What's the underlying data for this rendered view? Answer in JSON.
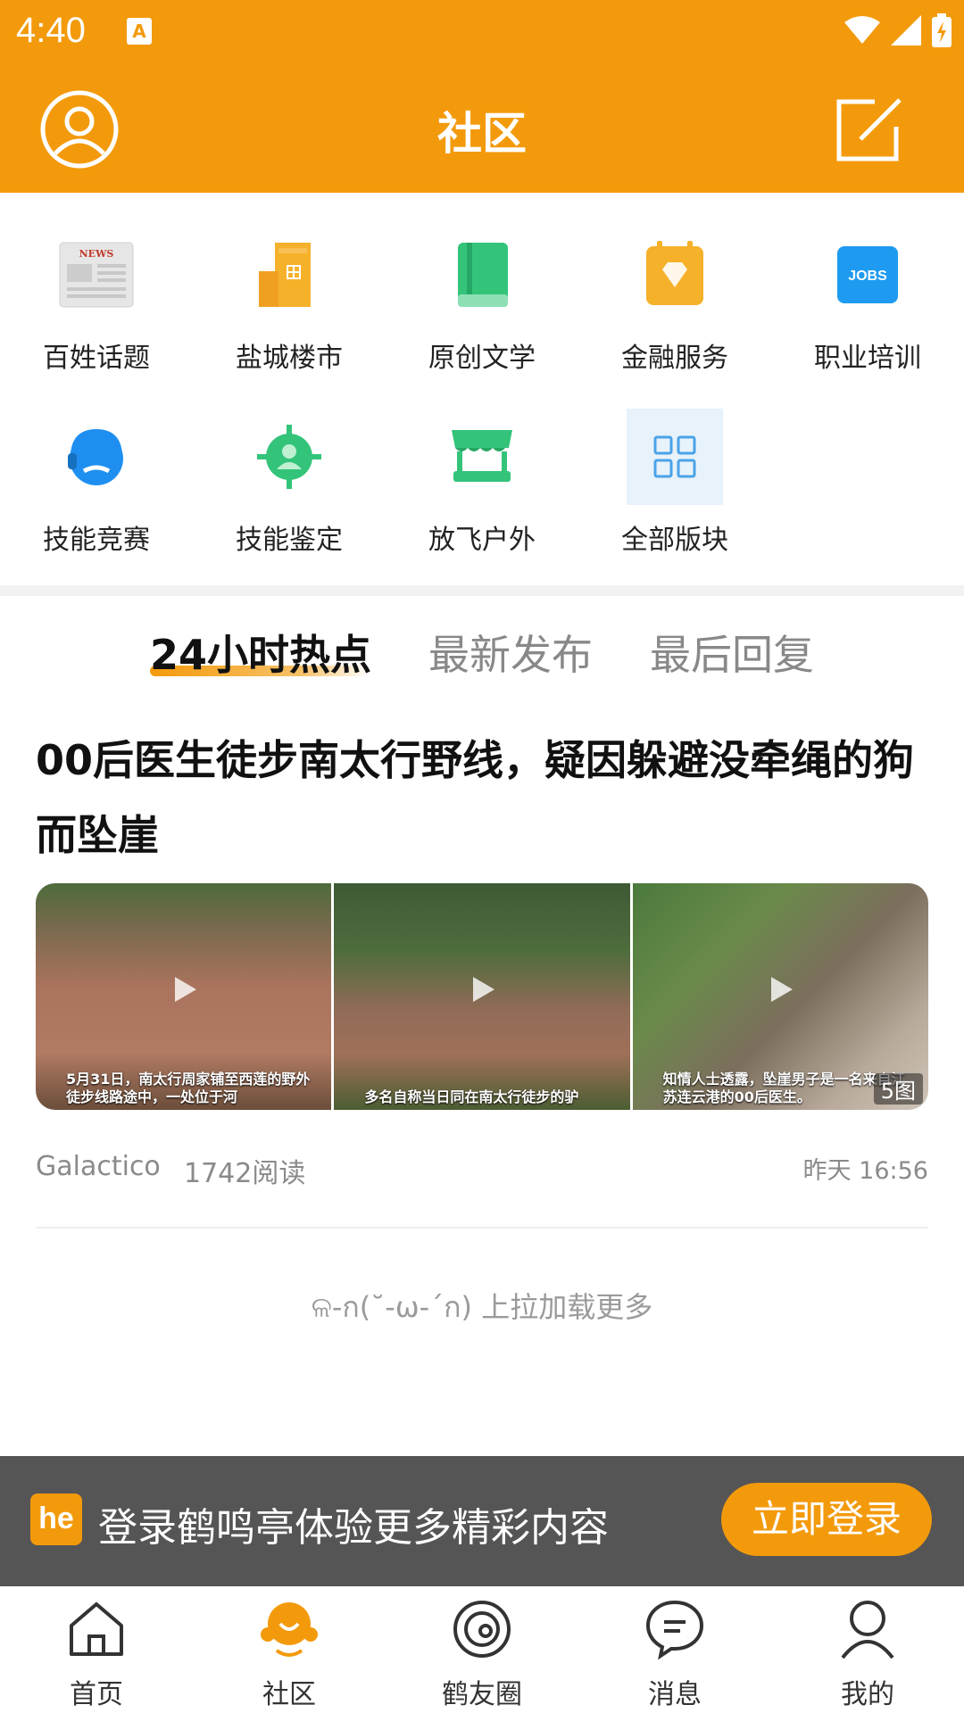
{
  "status_bar": {
    "time": "4:40",
    "a_badge": "A"
  },
  "header": {
    "title": "社区"
  },
  "categories": [
    {
      "label": "百姓话题",
      "icon": "newspaper-icon"
    },
    {
      "label": "盐城楼市",
      "icon": "building-icon"
    },
    {
      "label": "原创文学",
      "icon": "book-icon"
    },
    {
      "label": "金融服务",
      "icon": "diamond-calendar-icon"
    },
    {
      "label": "职业培训",
      "icon": "jobs-icon"
    },
    {
      "label": "技能竞赛",
      "icon": "headset-icon"
    },
    {
      "label": "技能鉴定",
      "icon": "person-target-icon"
    },
    {
      "label": "放飞户外",
      "icon": "stall-icon"
    },
    {
      "label": "全部版块",
      "icon": "grid-icon"
    }
  ],
  "jobs_icon_text": "JOBS",
  "news_icon_text": "NEWS",
  "tabs": [
    {
      "label": "24小时热点",
      "active": true
    },
    {
      "label": "最新发布",
      "active": false
    },
    {
      "label": "最后回复",
      "active": false
    }
  ],
  "post": {
    "title": "00后医生徒步南太行野线，疑因躲避没牵绳的狗而坠崖",
    "image_captions": [
      "5月31日，南太行周家铺至西莲的野外徒步线路途中，一处位于河",
      "多名自称当日同在南太行徒步的驴",
      "知情人士透露，坠崖男子是一名来自江苏连云港的00后医生。"
    ],
    "image_count": "5图",
    "author": "Galactico",
    "reads": "1742阅读",
    "time": "昨天 16:56"
  },
  "load_more": "ଳ-ก(˘-ω-ˊก) 上拉加载更多",
  "login_banner": {
    "logo": "he",
    "text": "登录鹤鸣亭体验更多精彩内容",
    "button": "立即登录"
  },
  "bottom_nav": [
    {
      "label": "首页",
      "icon": "home-icon"
    },
    {
      "label": "社区",
      "icon": "community-icon",
      "active": true
    },
    {
      "label": "鹤友圈",
      "icon": "circle-icon"
    },
    {
      "label": "消息",
      "icon": "message-icon"
    },
    {
      "label": "我的",
      "icon": "profile-icon"
    }
  ],
  "colors": {
    "brand": "#f39a0c",
    "banner": "#555555"
  }
}
